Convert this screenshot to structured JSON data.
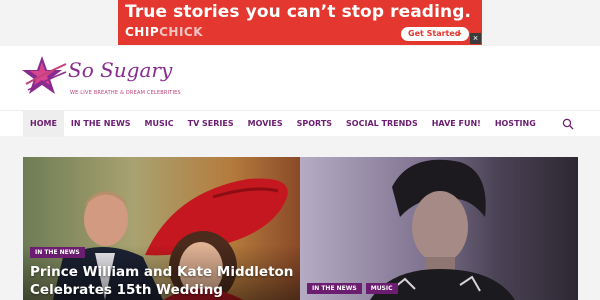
{
  "ad": {
    "headline": "True stories you can’t stop reading.",
    "brand_part1": "CHIP",
    "brand_part2": "CHICK",
    "cta_label": "Get Started",
    "cta_arrow": ">",
    "close_symbol": "×",
    "bg_color": "#e3372f"
  },
  "site": {
    "name": "So Sugary",
    "tagline": "WE LIVE BREATHE & DREAM CELEBRITIES",
    "brand_color": "#8a2c8f"
  },
  "nav": {
    "items": [
      {
        "label": "HOME",
        "active": true
      },
      {
        "label": "IN THE NEWS"
      },
      {
        "label": "MUSIC"
      },
      {
        "label": "TV SERIES"
      },
      {
        "label": "MOVIES"
      },
      {
        "label": "SPORTS"
      },
      {
        "label": "SOCIAL TRENDS"
      },
      {
        "label": "HAVE FUN!"
      },
      {
        "label": "HOSTING"
      }
    ],
    "search_icon": "search-icon"
  },
  "featured": [
    {
      "categories": [
        "IN THE NEWS"
      ],
      "title": "Prince William and Kate Middleton Celebrates 15th Wedding"
    },
    {
      "categories": [
        "IN THE NEWS",
        "MUSIC"
      ],
      "title": ""
    }
  ]
}
